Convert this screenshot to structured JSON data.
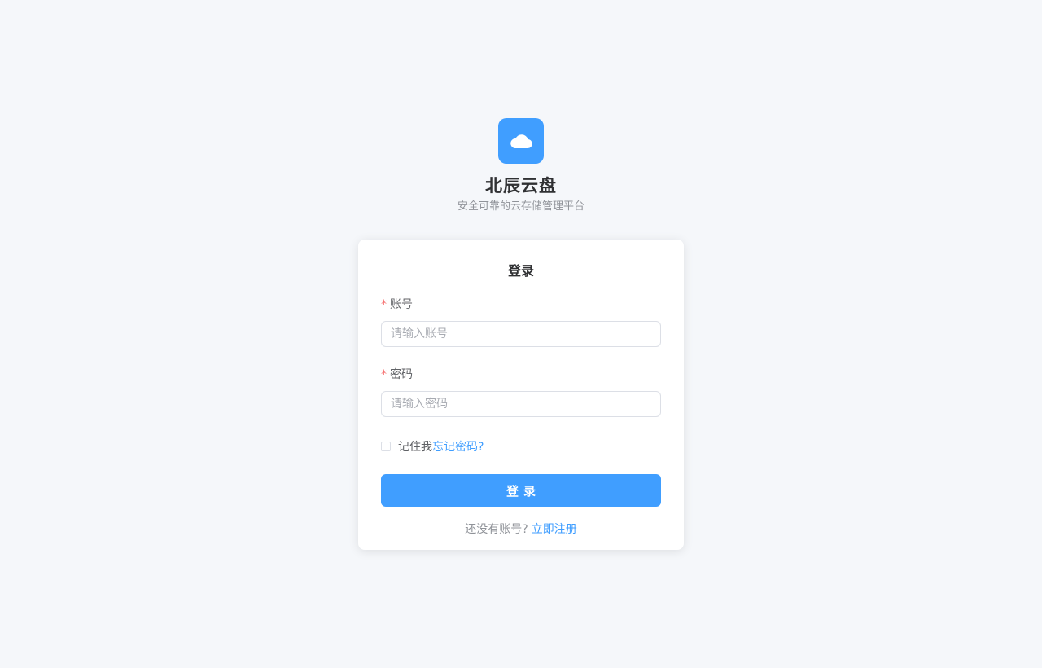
{
  "brand": {
    "logo_icon": "cloud-icon",
    "accent_color": "#409eff",
    "title": "北辰云盘",
    "subtitle": "安全可靠的云存储管理平台"
  },
  "login": {
    "title": "登录",
    "account": {
      "required_mark": "*",
      "label": "账号",
      "value": "",
      "placeholder": "请输入账号"
    },
    "password": {
      "required_mark": "*",
      "label": "密码",
      "value": "",
      "placeholder": "请输入密码"
    },
    "remember_label": "记住我",
    "remember_checked": false,
    "forgot_link": "忘记密码?",
    "submit_label": "登录",
    "register_prompt": "还没有账号?",
    "register_link": "立即注册"
  }
}
